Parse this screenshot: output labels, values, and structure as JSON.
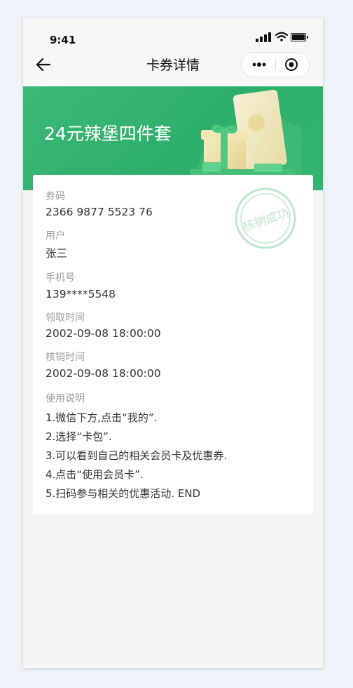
{
  "status_bar": {
    "time": "9:41"
  },
  "nav": {
    "title": "卡券详情"
  },
  "banner": {
    "title": "24元辣堡四件套",
    "color": "#33b46f"
  },
  "stamp": {
    "text": "核销成功"
  },
  "fields": [
    {
      "label": "券码",
      "value": "2366 9877 5523 76"
    },
    {
      "label": "用户",
      "value": "张三"
    },
    {
      "label": "手机号",
      "value": "139****5548"
    },
    {
      "label": "领取时间",
      "value": "2002-09-08  18:00:00"
    },
    {
      "label": "核销时间",
      "value": "2002-09-08  18:00:00"
    }
  ],
  "instructions": {
    "label": "使用说明",
    "lines": [
      "1.微信下方,点击“我的”.",
      "2.选择“卡包”.",
      "3.可以看到自己的相关会员卡及优惠券.",
      "4.点击“使用会员卡”.",
      "5.扫码参与相关的优惠活动. END"
    ]
  }
}
